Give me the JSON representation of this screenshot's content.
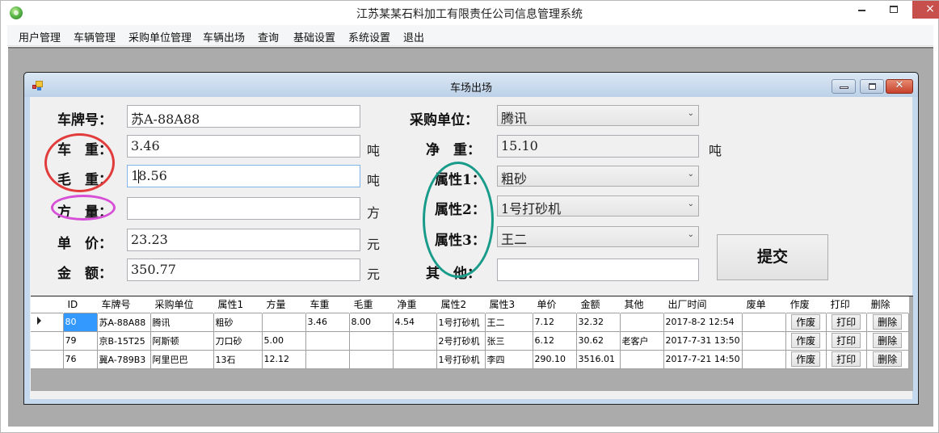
{
  "window": {
    "title": "江苏某某石料加工有限责任公司信息管理系统",
    "controls": {
      "minimize": "minimize",
      "maximize": "maximize",
      "close": "×"
    }
  },
  "menu": {
    "items": [
      "用户管理",
      "车辆管理",
      "采购单位管理",
      "车辆出场",
      "查询",
      "基础设置",
      "系统设置",
      "退出"
    ]
  },
  "child_window": {
    "title": "车场出场",
    "controls": {
      "close": "✕"
    }
  },
  "form": {
    "plate": {
      "label": "车牌号：",
      "value": "苏A-88A88"
    },
    "tare": {
      "label": "车　重：",
      "value": "3.46",
      "unit": "吨"
    },
    "gross": {
      "label": "毛　重：",
      "value_before_caret": "1",
      "value_after_caret": "8.56",
      "value": "18.56",
      "unit": "吨"
    },
    "volume": {
      "label": "方　量：",
      "value": "",
      "unit": "方"
    },
    "unit_price": {
      "label": "单　价：",
      "value": "23.23",
      "unit": "元"
    },
    "amount": {
      "label": "金　额：",
      "value": "350.77",
      "unit": "元"
    },
    "buyer": {
      "label": "采购单位：",
      "value": "腾讯"
    },
    "net": {
      "label": "净　重：",
      "value": "15.10",
      "unit": "吨"
    },
    "attr1": {
      "label": "属性1：",
      "value": "粗砂"
    },
    "attr2": {
      "label": "属性2：",
      "value": "1号打砂机"
    },
    "attr3": {
      "label": "属性3：",
      "value": "王二"
    },
    "other": {
      "label": "其　他：",
      "value": ""
    },
    "submit_label": "提交"
  },
  "annotation_colors": {
    "red": "#e23b3b",
    "magenta": "#d64fd6",
    "teal": "#199b8a"
  },
  "grid": {
    "columns": [
      "ID",
      "车牌号",
      "采购单位",
      "属性1",
      "方量",
      "车重",
      "毛重",
      "净重",
      "属性2",
      "属性3",
      "单价",
      "金额",
      "其他",
      "出厂时间",
      "废单",
      "作废",
      "打印",
      "删除"
    ],
    "rows": [
      {
        "id": "80",
        "plate": "苏A-88A88",
        "buyer": "腾讯",
        "attr1": "粗砂",
        "volume": "",
        "tare": "3.46",
        "gross": "8.00",
        "net": "4.54",
        "attr2": "1号打砂机",
        "attr3": "王二",
        "price": "7.12",
        "amount": "32.32",
        "other": "",
        "time": "2017-8-2 12:54",
        "void_flag": "",
        "void_btn": "作废",
        "print_btn": "打印",
        "delete_btn": "删除"
      },
      {
        "id": "79",
        "plate": "京B-15T25",
        "buyer": "阿斯顿",
        "attr1": "刀口砂",
        "volume": "5.00",
        "tare": "",
        "gross": "",
        "net": "",
        "attr2": "2号打砂机",
        "attr3": "张三",
        "price": "6.12",
        "amount": "30.62",
        "other": "老客户",
        "time": "2017-7-31 13:50",
        "void_flag": "",
        "void_btn": "作废",
        "print_btn": "打印",
        "delete_btn": "删除"
      },
      {
        "id": "76",
        "plate": "冀A-789B3",
        "buyer": "阿里巴巴",
        "attr1": "13石",
        "volume": "12.12",
        "tare": "",
        "gross": "",
        "net": "",
        "attr2": "1号打砂机",
        "attr3": "李四",
        "price": "290.10",
        "amount": "3516.01",
        "other": "",
        "time": "2017-7-21 14:50",
        "void_flag": "",
        "void_btn": "作废",
        "print_btn": "打印",
        "delete_btn": "删除"
      }
    ]
  }
}
